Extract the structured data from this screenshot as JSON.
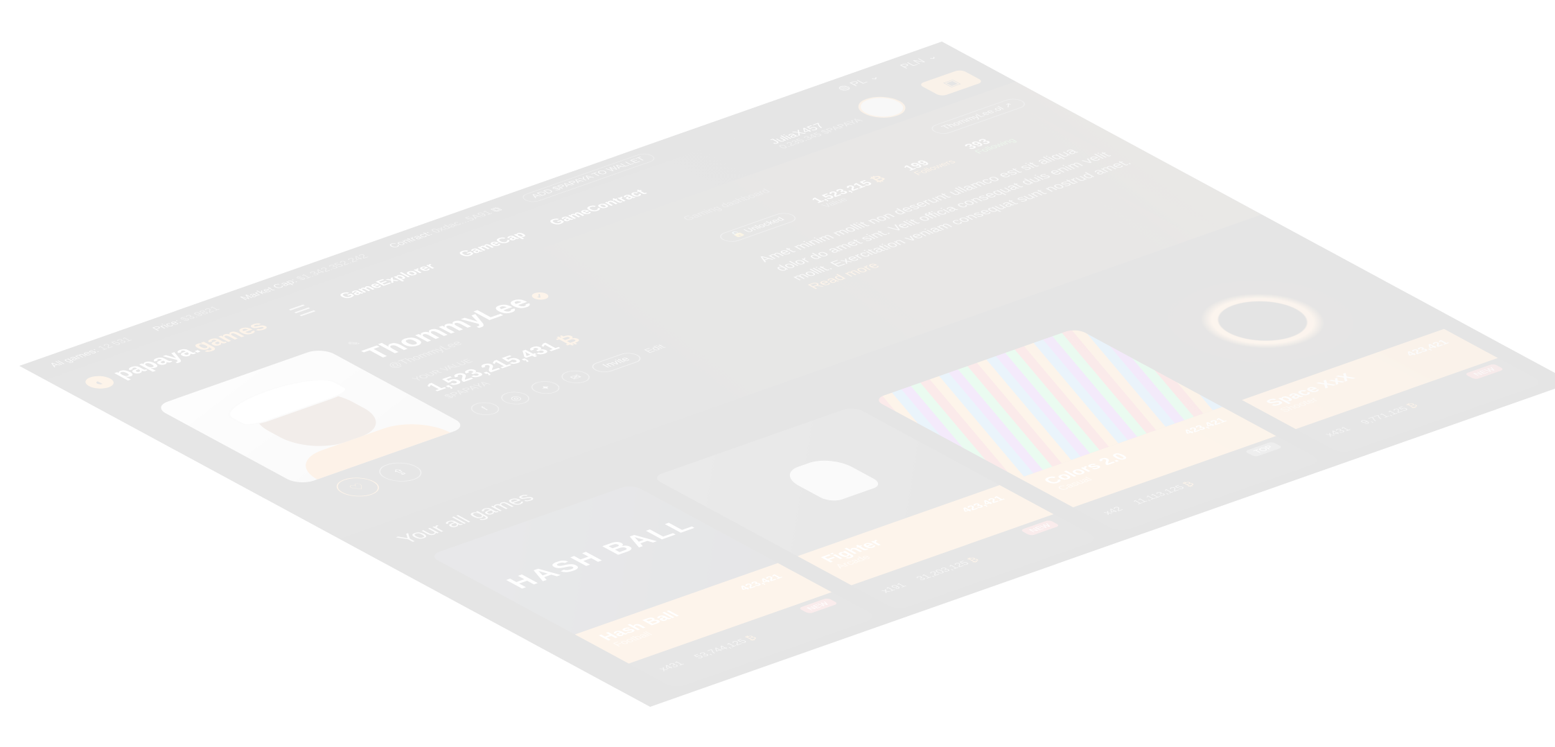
{
  "statbar": {
    "all_games_label": "All games:",
    "all_games_value": "12 531",
    "price_label": "Price:",
    "price_value": "$3.9821",
    "market_cap_label": "Market Cap:",
    "market_cap_value": "$1.342.352.242",
    "contract_label": "Contract:",
    "contract_value": "0xdac...5A91",
    "add_wallet": "ADD $PAPAYA TO WALLET",
    "language": "PL",
    "currency": "PLN"
  },
  "header": {
    "logo_main": "papaya.",
    "logo_accent": "games",
    "nav": [
      "GameExplorer",
      "GameCap",
      "GameContract"
    ],
    "user_name": "JuliaX457",
    "user_balance": "0.235.345 $PAPAYA"
  },
  "profile": {
    "name": "ThommyLee",
    "handle": "@ThommyLee",
    "value_label": "YOUR VALUE",
    "value": "1,523,215,431",
    "value_sub": "$PAPAYA",
    "invite": "Invite",
    "edit": "Edit"
  },
  "info": {
    "ghost_label": "Gaming dashboard",
    "top_tag": "ThommyLee.ol",
    "unlocked_tag": "Unlocked",
    "stats": [
      {
        "num": "1,523,215",
        "label": "Value",
        "tone": ""
      },
      {
        "num": "199",
        "label": "Followers",
        "tone": "orange"
      },
      {
        "num": "393",
        "label": "Following",
        "tone": "green"
      }
    ],
    "description": "Amet minim mollit non deserunt ullamco est sit aliqua dolor do amet sint. Velit officia consequat duis enim velit mollit. Exercitation veniam consequat sunt nostrud amet.",
    "read_more": "Read more"
  },
  "games": {
    "title": "Your all games",
    "cards": [
      {
        "name": "Hash Ball",
        "sub": "Football",
        "value": "423,421",
        "badge": "NEW",
        "players": "x431",
        "amount": "53,744,125",
        "art": "HASH BALL"
      },
      {
        "name": "Fighter",
        "sub": "Arcade",
        "value": "423,421",
        "badge": "NEW",
        "players": "x191",
        "amount": "31,203,125",
        "art": ""
      },
      {
        "name": "Colors 2.0",
        "sub": "Casual",
        "value": "423,421",
        "badge": "TOP",
        "players": "x42",
        "amount": "11,113,125",
        "art": ""
      },
      {
        "name": "Space XxX",
        "sub": "Shooter",
        "value": "423,421",
        "badge": "NEW",
        "players": "x431",
        "amount": "9,771,125",
        "art": ""
      }
    ]
  }
}
